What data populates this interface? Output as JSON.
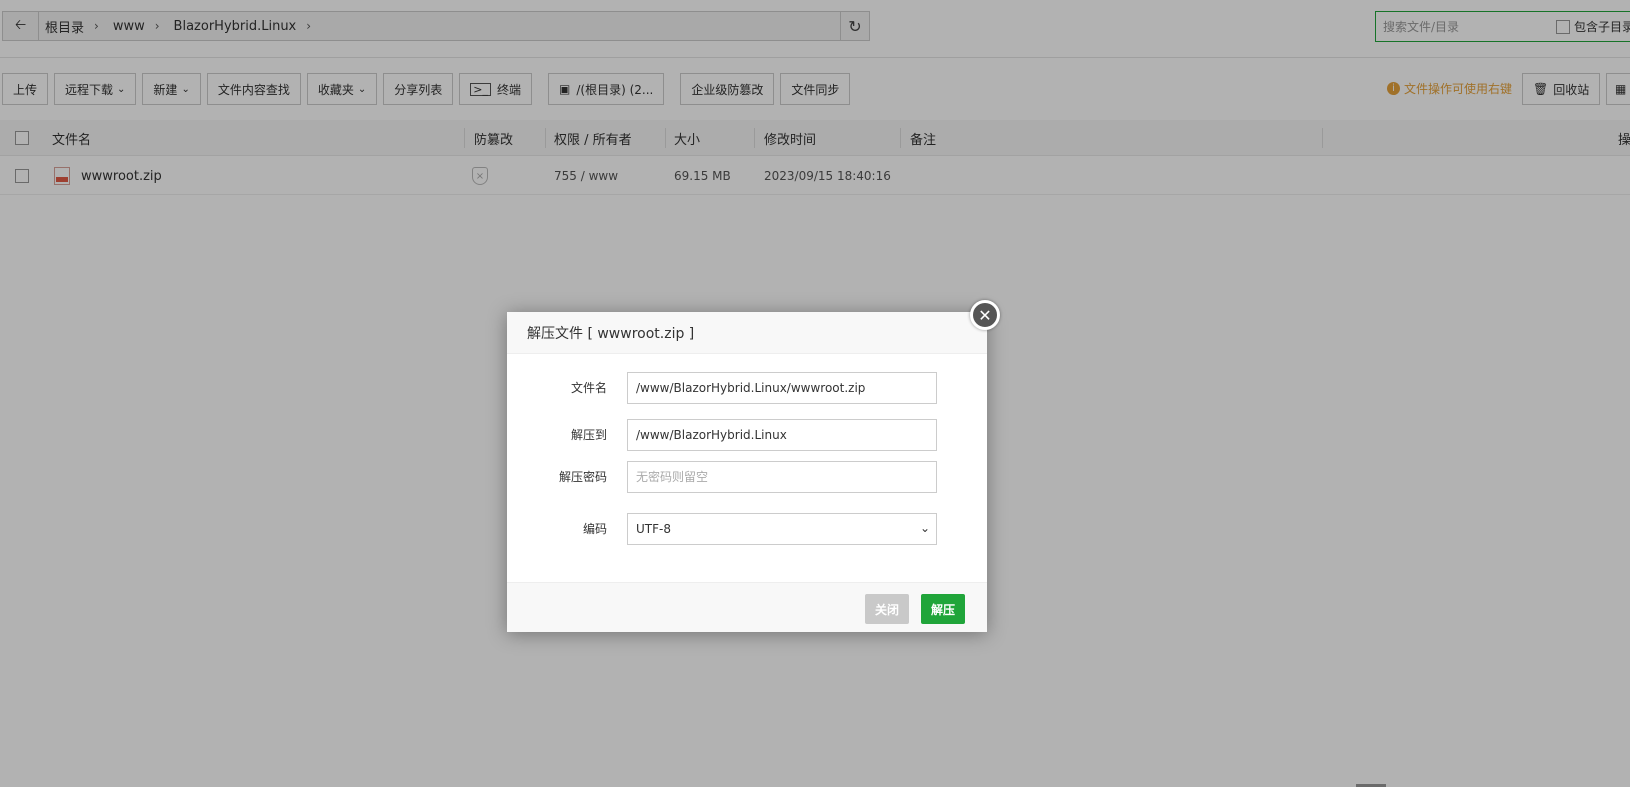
{
  "breadcrumb": {
    "items": [
      "根目录",
      "www",
      "BlazorHybrid.Linux"
    ]
  },
  "search": {
    "placeholder": "搜索文件/目录",
    "include_subdir_label": "包含子目录"
  },
  "toolbar": {
    "upload": "上传",
    "remote_download": "远程下载",
    "new": "新建",
    "content_search": "文件内容查找",
    "favorites": "收藏夹",
    "share_list": "分享列表",
    "terminal": "终端",
    "disk": "/(根目录) (2...",
    "tamper_protect": "企业级防篡改",
    "file_sync": "文件同步",
    "tip": "文件操作可使用右键",
    "recycle_bin": "回收站"
  },
  "table": {
    "headers": {
      "name": "文件名",
      "tamper": "防篡改",
      "permission": "权限 / 所有者",
      "size": "大小",
      "mtime": "修改时间",
      "remark": "备注",
      "op": "操"
    },
    "rows": [
      {
        "name": "wwwroot.zip",
        "permission": "755 / www",
        "size": "69.15 MB",
        "mtime": "2023/09/15 18:40:16",
        "remark": ""
      }
    ]
  },
  "dialog": {
    "title": "解压文件 [ wwwroot.zip ]",
    "fields": {
      "filename_label": "文件名",
      "filename_value": "/www/BlazorHybrid.Linux/wwwroot.zip",
      "extract_to_label": "解压到",
      "extract_to_value": "/www/BlazorHybrid.Linux",
      "password_label": "解压密码",
      "password_placeholder": "无密码则留空",
      "encoding_label": "编码",
      "encoding_value": "UTF-8"
    },
    "buttons": {
      "close": "关闭",
      "extract": "解压"
    }
  },
  "colors": {
    "primary": "#20a53a",
    "tip": "#e6a23c",
    "overlay": "rgba(0,0,0,0.30)"
  }
}
